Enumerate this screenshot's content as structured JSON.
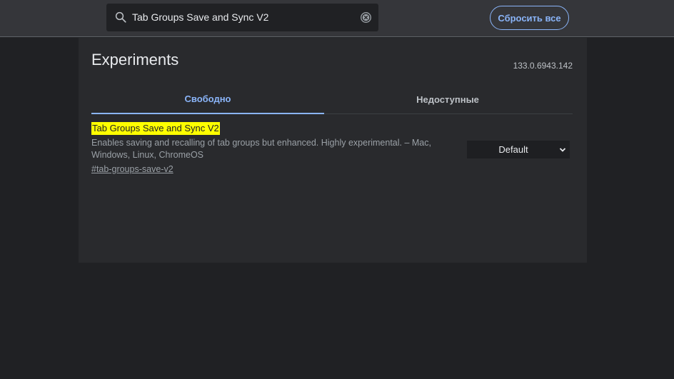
{
  "header": {
    "search": {
      "value": "Tab Groups Save and Sync V2",
      "icon": "search-icon",
      "clear_icon": "clear-icon"
    },
    "reset_label": "Сбросить все"
  },
  "page": {
    "title": "Experiments",
    "version": "133.0.6943.142"
  },
  "tabs": [
    {
      "label": "Свободно",
      "active": true
    },
    {
      "label": "Недоступные",
      "active": false
    }
  ],
  "experiments": [
    {
      "title": "Tab Groups Save and Sync V2",
      "description": "Enables saving and recalling of tab groups but enhanced. Highly experimental. – Mac, Windows, Linux, ChromeOS",
      "link": "#tab-groups-save-v2",
      "selected_option": "Default"
    }
  ],
  "colors": {
    "accent": "#8ab4f8",
    "highlight": "#ffff00",
    "background": "#202124",
    "header_bg": "#35363a",
    "panel_bg": "#292a2d"
  }
}
